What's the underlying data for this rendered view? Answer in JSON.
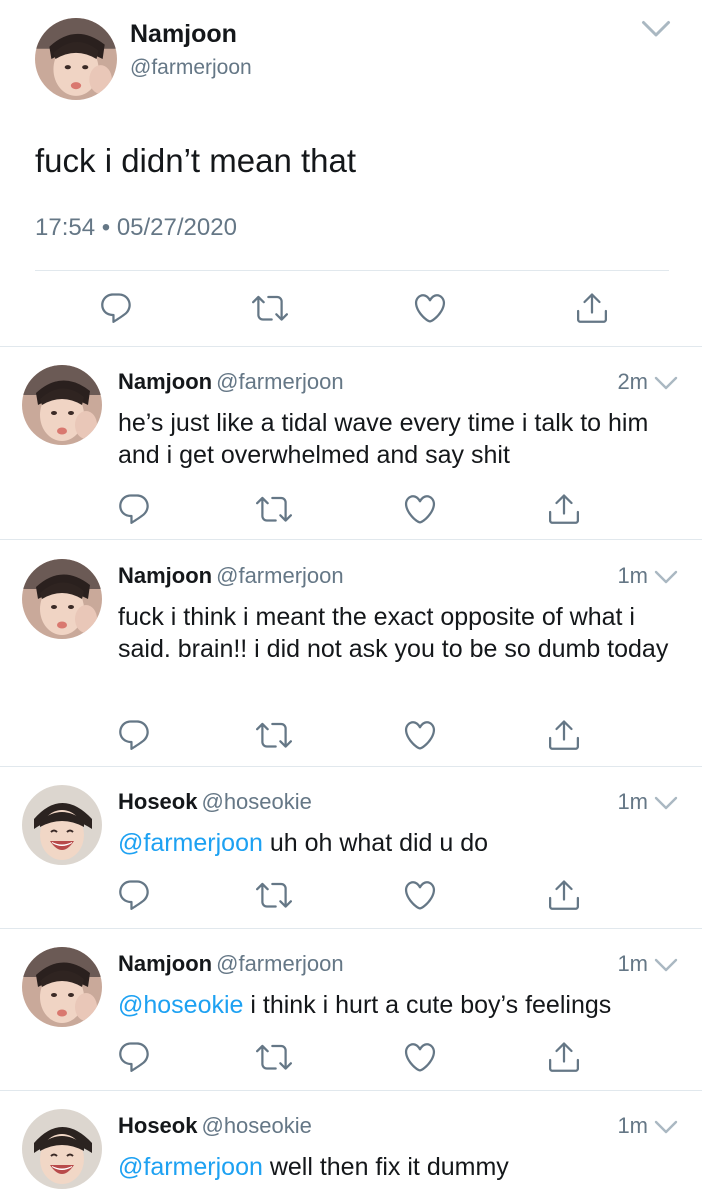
{
  "main": {
    "name": "Namjoon",
    "handle": "@farmerjoon",
    "text": "fuck i didn’t mean that",
    "time": "17:54",
    "date": "05/27/2020",
    "avatar_icon": "namjoon-avatar"
  },
  "replies": [
    {
      "name": "Namjoon",
      "handle": "@farmerjoon",
      "time": "2m",
      "mention": "",
      "text": "he’s just like a tidal wave every time i talk to him and i get overwhelmed and say shit",
      "avatar_icon": "namjoon-avatar"
    },
    {
      "name": "Namjoon",
      "handle": "@farmerjoon",
      "time": "1m",
      "mention": "",
      "text": "fuck i think i meant the exact opposite of what i said. brain!! i did not ask you to be so dumb today",
      "avatar_icon": "namjoon-avatar"
    },
    {
      "name": "Hoseok",
      "handle": "@hoseokie",
      "time": "1m",
      "mention": "@farmerjoon",
      "text": " uh oh what did u do",
      "avatar_icon": "hoseok-avatar"
    },
    {
      "name": "Namjoon",
      "handle": "@farmerjoon",
      "time": "1m",
      "mention": "@hoseokie",
      "text": " i think i hurt a cute boy’s feelings",
      "avatar_icon": "namjoon-avatar"
    },
    {
      "name": "Hoseok",
      "handle": "@hoseokie",
      "time": "1m",
      "mention": "@farmerjoon",
      "text": " well then fix it dummy",
      "avatar_icon": "hoseok-avatar"
    }
  ],
  "colors": {
    "text": "#14171a",
    "secondary": "#657786",
    "link": "#1da1f2",
    "divider": "#e1e8ed",
    "icon": "#657786"
  }
}
